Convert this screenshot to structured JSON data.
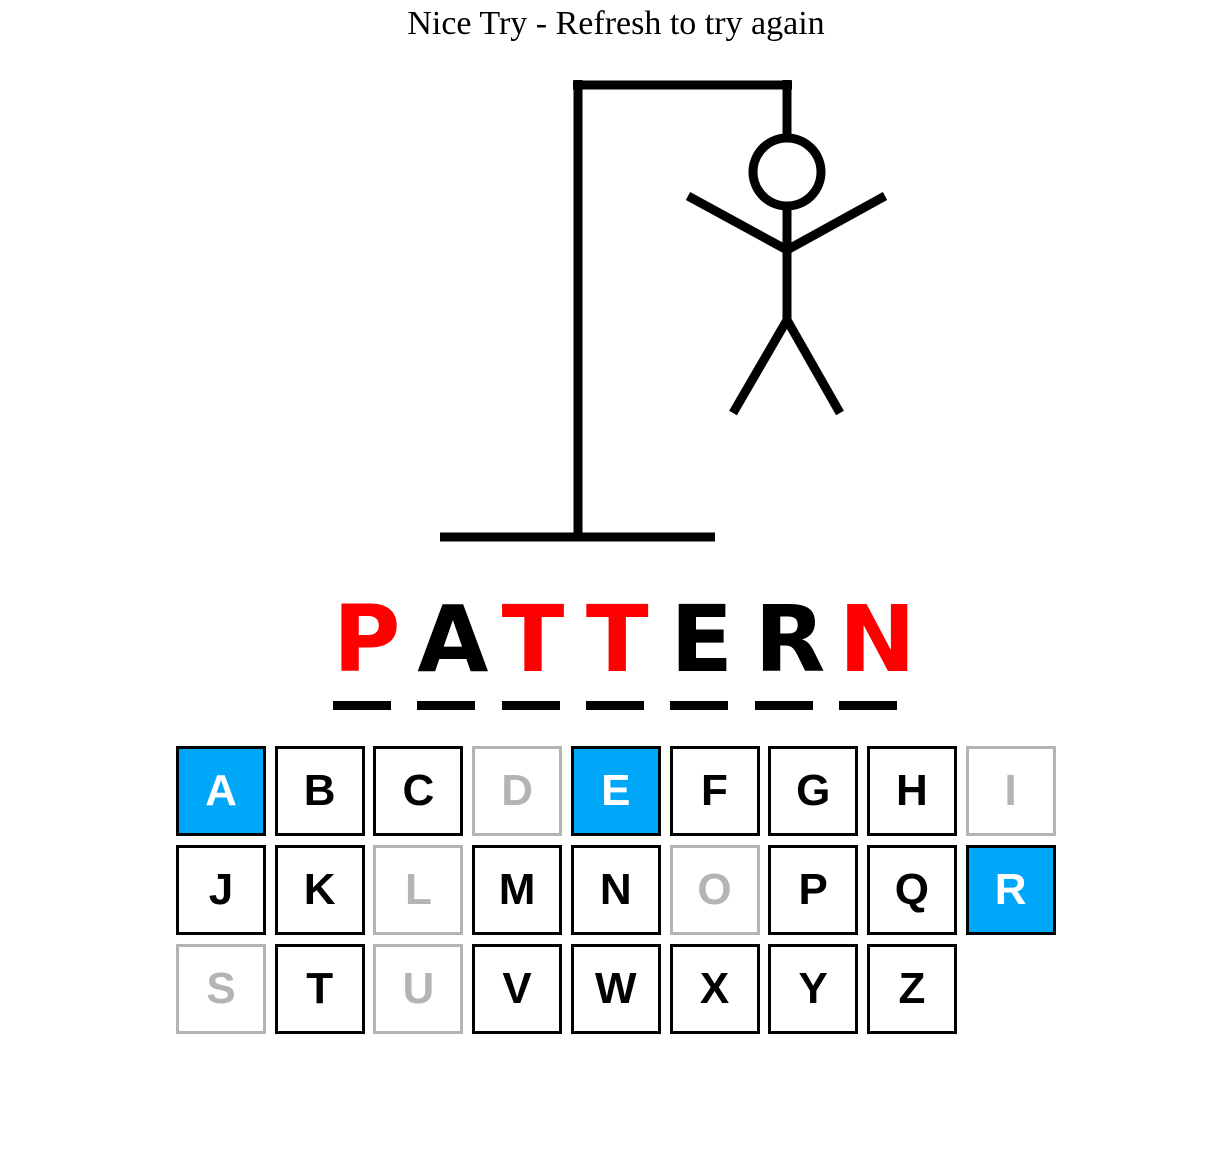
{
  "message": "Nice Try - Refresh to try again",
  "colors": {
    "correct_bg": "#00a6f7",
    "used_gray": "#b4b4b4",
    "missed_letter": "#ff0000",
    "guessed_letter": "#000000"
  },
  "word": [
    {
      "letter": "P",
      "revealed": false
    },
    {
      "letter": "A",
      "revealed": true
    },
    {
      "letter": "T",
      "revealed": false
    },
    {
      "letter": "T",
      "revealed": false
    },
    {
      "letter": "E",
      "revealed": true
    },
    {
      "letter": "R",
      "revealed": true
    },
    {
      "letter": "N",
      "revealed": false
    }
  ],
  "keyboard": [
    {
      "letter": "A",
      "state": "correct"
    },
    {
      "letter": "B",
      "state": "available"
    },
    {
      "letter": "C",
      "state": "available"
    },
    {
      "letter": "D",
      "state": "used"
    },
    {
      "letter": "E",
      "state": "correct"
    },
    {
      "letter": "F",
      "state": "available"
    },
    {
      "letter": "G",
      "state": "available"
    },
    {
      "letter": "H",
      "state": "available"
    },
    {
      "letter": "I",
      "state": "used"
    },
    {
      "letter": "J",
      "state": "available"
    },
    {
      "letter": "K",
      "state": "available"
    },
    {
      "letter": "L",
      "state": "used"
    },
    {
      "letter": "M",
      "state": "available"
    },
    {
      "letter": "N",
      "state": "available"
    },
    {
      "letter": "O",
      "state": "used"
    },
    {
      "letter": "P",
      "state": "available"
    },
    {
      "letter": "Q",
      "state": "available"
    },
    {
      "letter": "R",
      "state": "correct"
    },
    {
      "letter": "S",
      "state": "used"
    },
    {
      "letter": "T",
      "state": "available"
    },
    {
      "letter": "U",
      "state": "used"
    },
    {
      "letter": "V",
      "state": "available"
    },
    {
      "letter": "W",
      "state": "available"
    },
    {
      "letter": "X",
      "state": "available"
    },
    {
      "letter": "Y",
      "state": "available"
    },
    {
      "letter": "Z",
      "state": "available"
    }
  ]
}
